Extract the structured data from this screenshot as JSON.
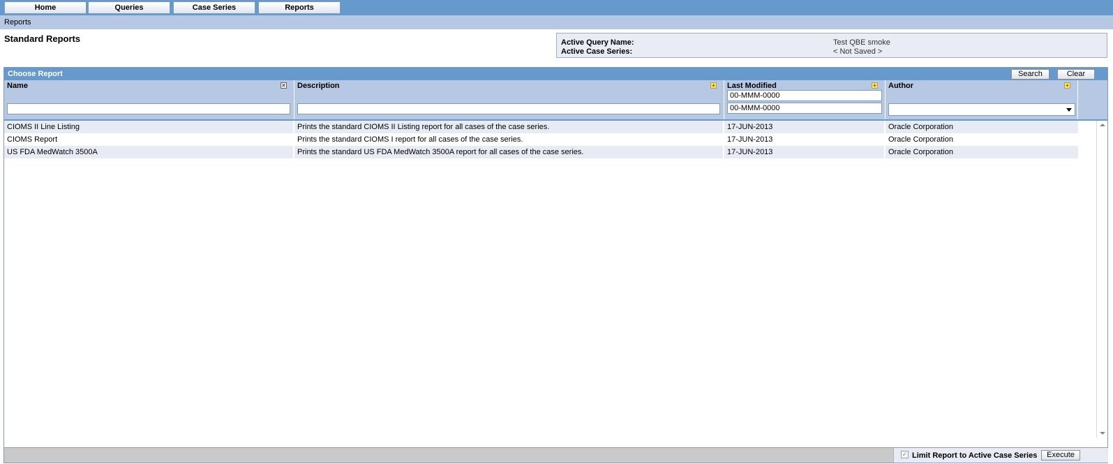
{
  "nav": {
    "tabs": [
      {
        "label": "Home"
      },
      {
        "label": "Queries"
      },
      {
        "label": "Case Series"
      },
      {
        "label": "Reports"
      }
    ],
    "breadcrumb": "Reports"
  },
  "page": {
    "title": "Standard Reports"
  },
  "active_info": {
    "query_label": "Active Query Name:",
    "query_value": "Test QBE smoke",
    "case_series_label": "Active Case Series:",
    "case_series_value": "< Not Saved >"
  },
  "panel": {
    "title": "Choose Report",
    "search_label": "Search",
    "clear_label": "Clear",
    "columns": [
      {
        "label": "Name"
      },
      {
        "label": "Description"
      },
      {
        "label": "Last Modified"
      },
      {
        "label": "Author"
      }
    ],
    "filters": {
      "name_value": "",
      "description_value": "",
      "last_modified_from": "00-MMM-0000",
      "last_modified_to": "00-MMM-0000",
      "author_selected": ""
    },
    "rows": [
      {
        "name": "CIOMS II Line Listing",
        "description": "Prints the standard CIOMS II Listing report for all cases of the case series.",
        "last_modified": "17-JUN-2013",
        "author": "Oracle Corporation"
      },
      {
        "name": "CIOMS Report",
        "description": "Prints the standard CIOMS I report for all cases of the case series.",
        "last_modified": "17-JUN-2013",
        "author": "Oracle Corporation"
      },
      {
        "name": "US FDA MedWatch 3500A",
        "description": "Prints the standard US FDA MedWatch 3500A report for all cases of the case series.",
        "last_modified": "17-JUN-2013",
        "author": "Oracle Corporation"
      }
    ]
  },
  "footer": {
    "limit_label": "Limit Report to Active Case Series",
    "limit_checked": true,
    "execute_label": "Execute"
  },
  "colors": {
    "nav_bg": "#6699cc",
    "breadcrumb_bg": "#b6c8e4",
    "row_alt": "#e8eaf4"
  }
}
